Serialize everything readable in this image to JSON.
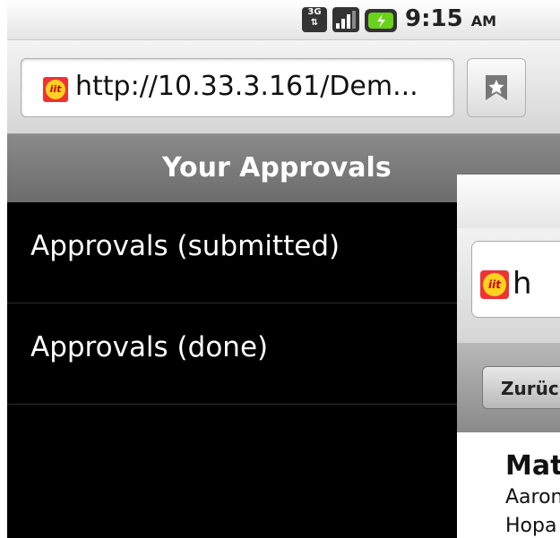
{
  "status_bar": {
    "network": "3G",
    "time": "9:15",
    "ampm": "AM"
  },
  "browser": {
    "url": "http://10.33.3.161/Dem...",
    "favicon_text": "iit"
  },
  "header": {
    "title": "Your Approvals"
  },
  "menu": {
    "items": [
      {
        "label": "Approvals (submitted)"
      },
      {
        "label": "Approvals (done)"
      }
    ]
  },
  "overlay": {
    "url": "h",
    "back_label": "Zurüc",
    "name": "Mat",
    "line1": "Aaron",
    "line2": "Hopa"
  }
}
